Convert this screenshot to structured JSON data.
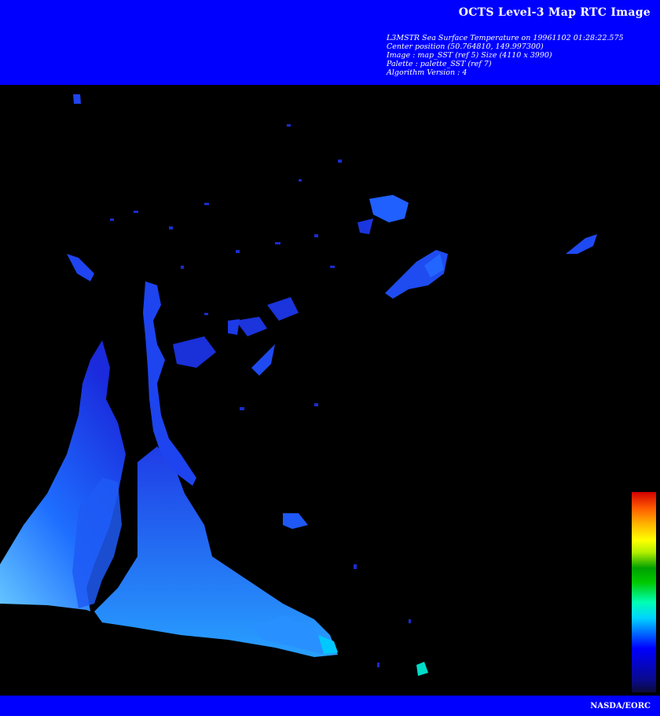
{
  "header": {
    "title": "OCTS Level-3 Map RTC Image",
    "meta_lines": [
      "L3MSTR Sea Surface Temperature on 19961102 01:28:22.575",
      "Center position (50.764810, 149.997300)",
      "Image : map_SST (ref 5) Size (4110 x 3990)",
      "Palette : palette_SST (ref 7)",
      "Algorithm Version : 4"
    ]
  },
  "colors": {
    "banner": "#0000ff",
    "background": "#000000",
    "text": "#ffffff",
    "sst_low": "#1414c8",
    "sst_mid": "#1e64ff",
    "sst_high": "#00e6c8"
  },
  "legend": {
    "type": "color-scale",
    "stops": [
      "#0a0a3a",
      "#0a0a8a",
      "#0000ff",
      "#00d2ff",
      "#00ffb4",
      "#00c800",
      "#00a000",
      "#b4f000",
      "#ffff00",
      "#ffb400",
      "#ff5a00",
      "#d20000"
    ]
  },
  "footer": {
    "credit": "NASDA/EORC"
  }
}
